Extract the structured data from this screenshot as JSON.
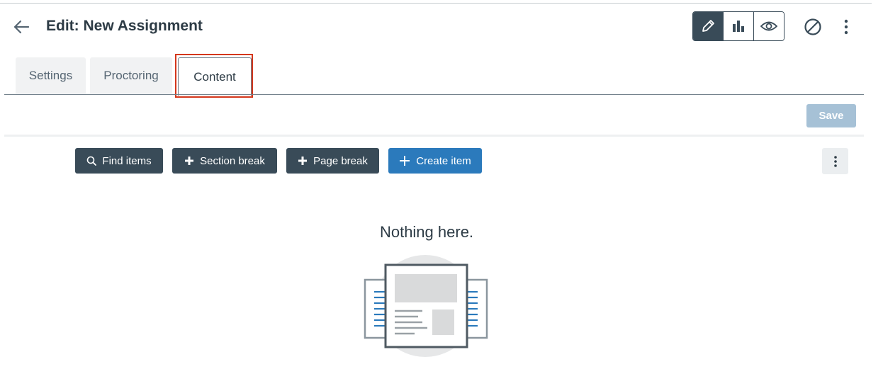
{
  "header": {
    "title": "Edit: New Assignment",
    "back_icon": "arrow-left-icon",
    "modes": [
      {
        "name": "edit",
        "icon": "pencil-icon"
      },
      {
        "name": "stats",
        "icon": "bar-chart-icon"
      },
      {
        "name": "preview",
        "icon": "eye-icon"
      }
    ],
    "unpublish_icon": "ban-icon",
    "more_icon": "kebab-icon"
  },
  "tabs": [
    {
      "label": "Settings"
    },
    {
      "label": "Proctoring"
    },
    {
      "label": "Content",
      "selected": true
    }
  ],
  "save_label": "Save",
  "toolbar": {
    "find_label": "Find items",
    "section_label": "Section break",
    "page_label": "Page break",
    "create_label": "Create item"
  },
  "empty_state": {
    "message": "Nothing here."
  },
  "colors": {
    "dark": "#394b58",
    "primary": "#2b7abc",
    "save_disabled": "#a6c1d6",
    "highlight": "#d4371c"
  }
}
